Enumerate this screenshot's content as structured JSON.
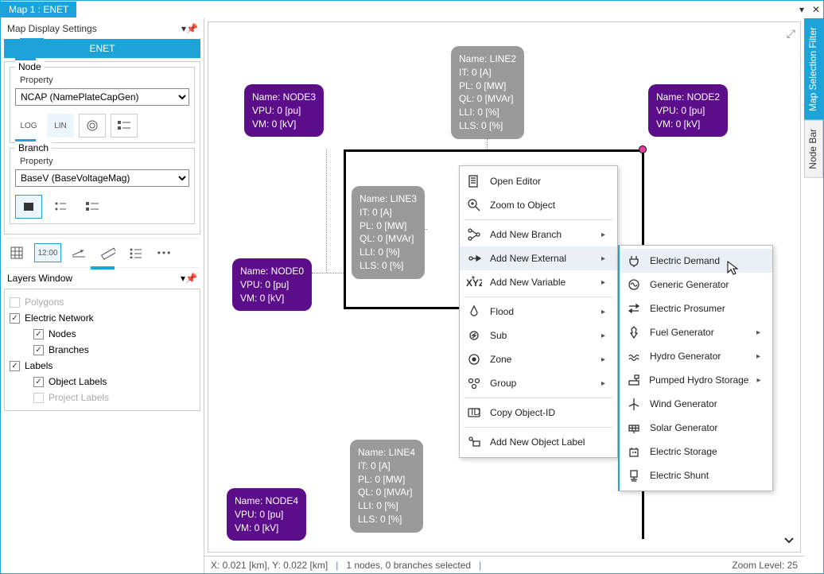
{
  "title": "Map 1 : ENET",
  "settings_title": "Map Display Settings",
  "settings_tab": "ENET",
  "node_group": {
    "legend": "Node",
    "sub": "Property",
    "select": "NCAP (NamePlateCapGen)",
    "btns": {
      "log": "LOG",
      "lin": "LIN"
    }
  },
  "branch_group": {
    "legend": "Branch",
    "sub": "Property",
    "select": "BaseV (BaseVoltageMag)"
  },
  "time_label": "12:00",
  "layers_title": "Layers Window",
  "layers": {
    "polygons": "Polygons",
    "elec": "Electric Network",
    "nodes": "Nodes",
    "branches": "Branches",
    "labels": "Labels",
    "obj_labels": "Object Labels",
    "proj_labels": "Project Labels"
  },
  "nodes": {
    "n3": [
      "Name: NODE3",
      "VPU: 0 [pu]",
      "VM: 0 [kV]"
    ],
    "n0": [
      "Name: NODE0",
      "VPU: 0 [pu]",
      "VM: 0 [kV]"
    ],
    "n4": [
      "Name: NODE4",
      "VPU: 0 [pu]",
      "VM: 0 [kV]"
    ],
    "n2": [
      "Name: NODE2",
      "VPU: 0 [pu]",
      "VM: 0 [kV]"
    ]
  },
  "lines": {
    "l2": [
      "Name: LINE2",
      "IT: 0 [A]",
      "PL: 0 [MW]",
      "QL: 0 [MVAr]",
      "LLI: 0 [%]",
      "LLS: 0 [%]"
    ],
    "l3": [
      "Name: LINE3",
      "IT: 0 [A]",
      "PL: 0 [MW]",
      "QL: 0 [MVAr]",
      "LLI: 0 [%]",
      "LLS: 0 [%]"
    ],
    "l4": [
      "Name: LINE4",
      "IT: 0 [A]",
      "PL: 0 [MW]",
      "QL: 0 [MVAr]",
      "LLI: 0 [%]",
      "LLS: 0 [%]"
    ]
  },
  "ctx_main": [
    {
      "label": "Open Editor",
      "icon": "editor"
    },
    {
      "label": "Zoom to Object",
      "icon": "zoom"
    },
    {
      "label": "Add New Branch",
      "icon": "branch",
      "sub": true,
      "div_before": true
    },
    {
      "label": "Add New External",
      "icon": "external",
      "sub": true,
      "active": true
    },
    {
      "label": "Add New Variable",
      "icon": "xyz",
      "sub": true
    },
    {
      "label": "Flood",
      "icon": "flood",
      "sub": true,
      "div_before": true
    },
    {
      "label": "Sub",
      "icon": "sub",
      "sub": true
    },
    {
      "label": "Zone",
      "icon": "zone",
      "sub": true
    },
    {
      "label": "Group",
      "icon": "group",
      "sub": true
    },
    {
      "label": "Copy Object-ID",
      "icon": "id",
      "div_before": true
    },
    {
      "label": "Add New Object Label",
      "icon": "label",
      "div_before": true
    }
  ],
  "ctx_sub": [
    {
      "label": "Electric Demand",
      "icon": "plug",
      "hover": true
    },
    {
      "label": "Generic Generator",
      "icon": "gen"
    },
    {
      "label": "Electric Prosumer",
      "icon": "prosumer"
    },
    {
      "label": "Fuel Generator",
      "icon": "fuel",
      "sub": true
    },
    {
      "label": "Hydro Generator",
      "icon": "hydro",
      "sub": true
    },
    {
      "label": "Pumped Hydro Storage",
      "icon": "pumped",
      "sub": true
    },
    {
      "label": "Wind Generator",
      "icon": "wind"
    },
    {
      "label": "Solar Generator",
      "icon": "solar"
    },
    {
      "label": "Electric Storage",
      "icon": "battery"
    },
    {
      "label": "Electric Shunt",
      "icon": "shunt"
    }
  ],
  "status": {
    "coords": "X: 0.021 [km], Y: 0.022 [km]",
    "sel": "1 nodes, 0 branches selected",
    "zoom": "Zoom Level: 25"
  },
  "right_tabs": {
    "filter": "Map Selection Filter",
    "nodebar": "Node Bar"
  }
}
